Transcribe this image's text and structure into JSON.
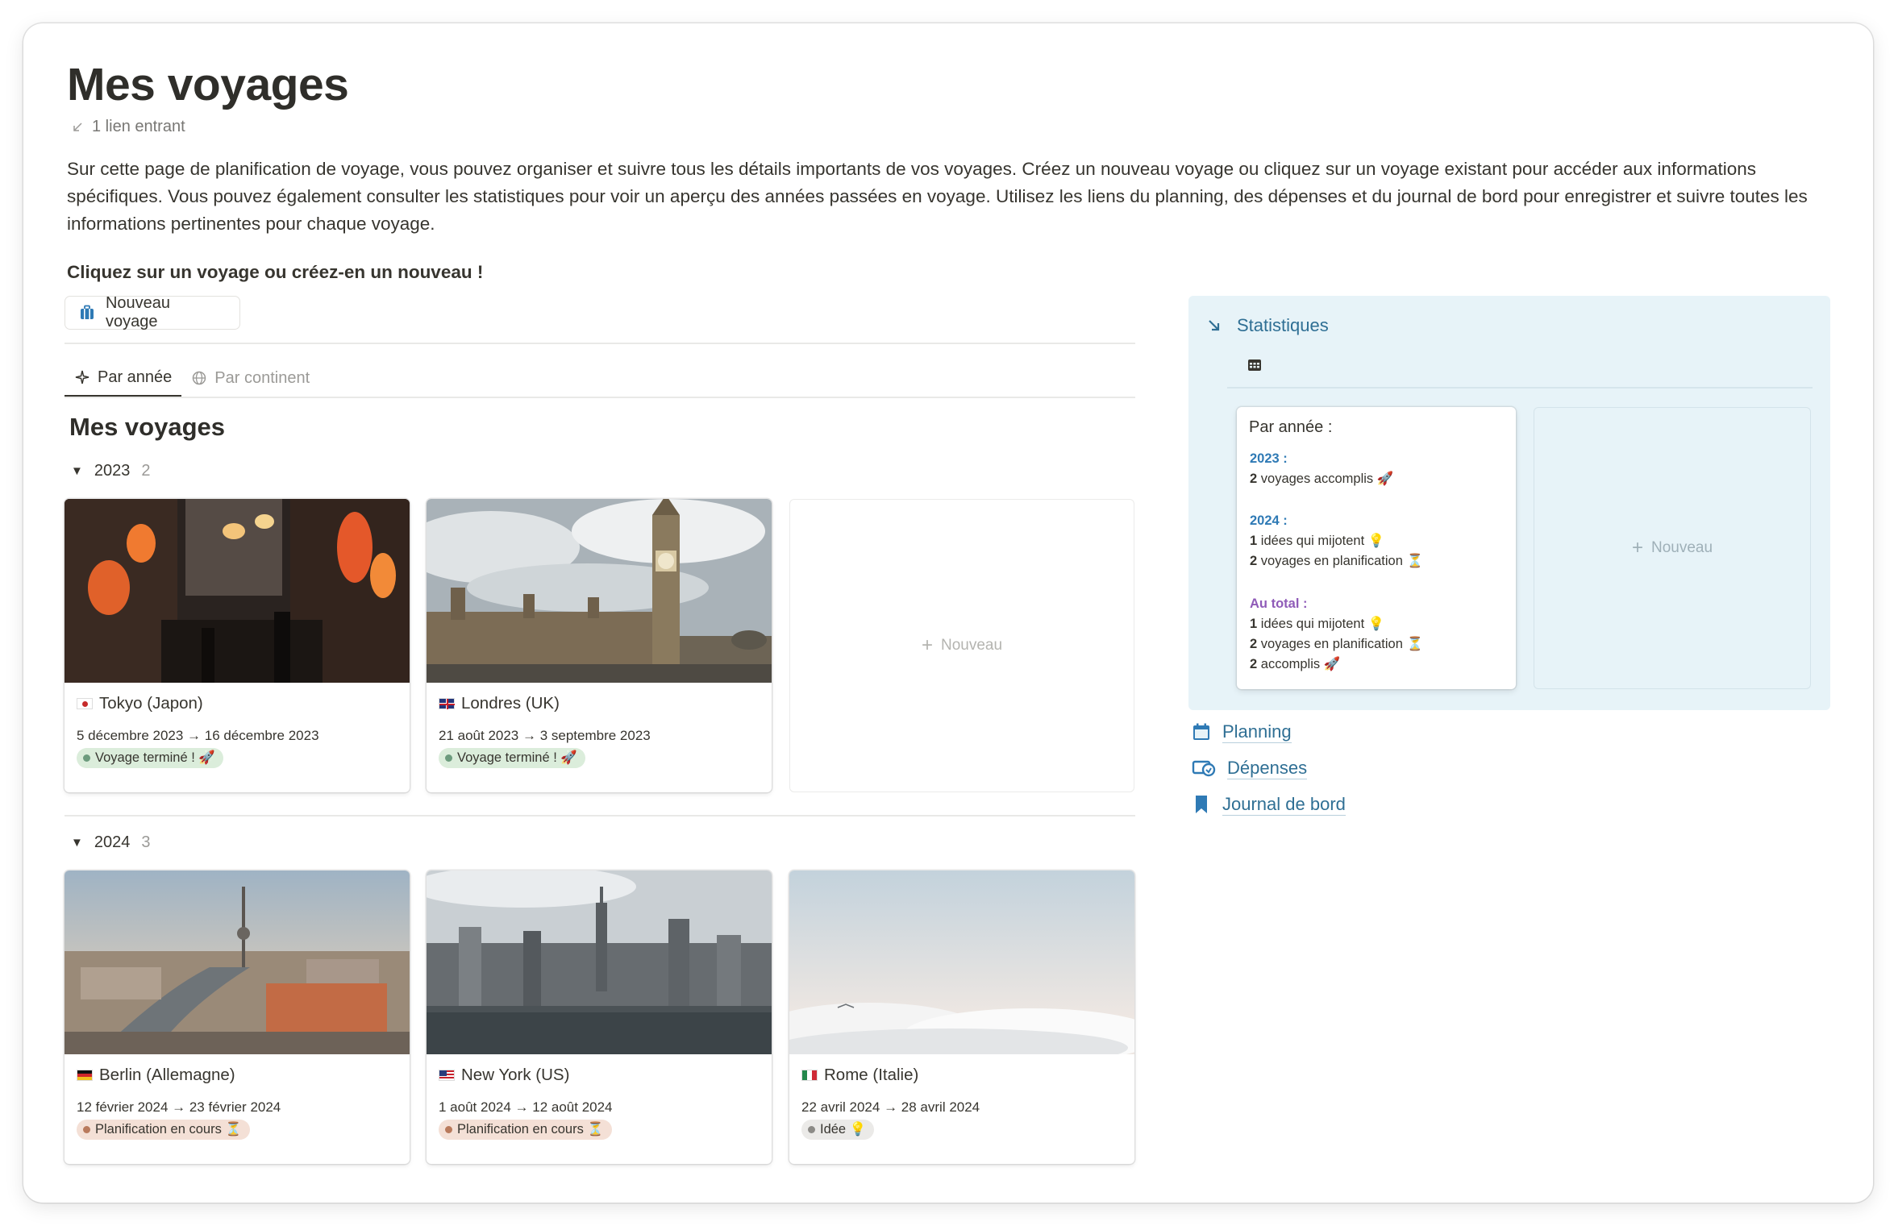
{
  "page": {
    "title": "Mes voyages",
    "backlinks": "1 lien entrant",
    "intro": "Sur cette page de planification de voyage, vous pouvez organiser et suivre tous les détails importants de vos voyages. Créez un nouveau voyage ou cliquez sur un voyage existant pour accéder aux informations spécifiques. Vous pouvez également consulter les statistiques pour voir un aperçu des années passées en voyage. Utilisez les liens du planning, des dépenses et du journal de bord pour enregistrer et suivre toutes les informations pertinentes pour chaque voyage.",
    "cta": "Cliquez sur un voyage ou créez-en un nouveau !",
    "new_trip_button": "Nouveau voyage"
  },
  "tabs": [
    {
      "label": "Par année",
      "icon": "sparkle-icon",
      "active": true
    },
    {
      "label": "Par continent",
      "icon": "globe-icon",
      "active": false
    }
  ],
  "database": {
    "title": "Mes voyages",
    "new_label": "Nouveau",
    "groups": [
      {
        "year": "2023",
        "count": "2",
        "cards": [
          {
            "name": "Tokyo (Japon)",
            "flag": "japan-flag",
            "dates": "5 décembre 2023 → 16 décembre 2023",
            "status": "Voyage terminé ! 🚀",
            "status_color": "#dbeddb",
            "dot_color": "#6c9b7d"
          },
          {
            "name": "Londres (UK)",
            "flag": "uk-flag",
            "dates": "21 août 2023 → 3 septembre 2023",
            "status": "Voyage terminé ! 🚀",
            "status_color": "#dbeddb",
            "dot_color": "#6c9b7d"
          }
        ]
      },
      {
        "year": "2024",
        "count": "3",
        "cards": [
          {
            "name": "Berlin (Allemagne)",
            "flag": "germany-flag",
            "dates": "12 février 2024 → 23 février 2024",
            "status": "Planification en cours ⏳",
            "status_color": "#f4e0d6",
            "dot_color": "#b97a5c"
          },
          {
            "name": "New York (US)",
            "flag": "usa-flag",
            "dates": "1 août 2024 → 12 août 2024",
            "status": "Planification en cours ⏳",
            "status_color": "#f4e0d6",
            "dot_color": "#b97a5c"
          },
          {
            "name": "Rome (Italie)",
            "flag": "italy-flag",
            "dates": "22 avril 2024 → 28 avril 2024",
            "status": "Idée 💡",
            "status_color": "#ebeae8",
            "dot_color": "#8c8b87"
          }
        ]
      }
    ]
  },
  "stats": {
    "title": "Statistiques",
    "new_label": "Nouveau",
    "card": {
      "head": "Par année :",
      "y2023_label": "2023 :",
      "y2023_done_n": "2",
      "y2023_done": " voyages accomplis 🚀",
      "y2024_label": "2024 :",
      "y2024_ideas_n": "1",
      "y2024_ideas": " idées qui mijotent 💡",
      "y2024_plan_n": "2",
      "y2024_plan": " voyages en planification ⏳",
      "total_label": "Au total :",
      "total_ideas_n": "1",
      "total_ideas": " idées qui mijotent 💡",
      "total_plan_n": "2",
      "total_plan": " voyages en planification ⏳",
      "total_done_n": "2",
      "total_done": " accomplis 🚀"
    }
  },
  "links": [
    {
      "label": "Planning",
      "icon": "calendar-icon"
    },
    {
      "label": "Dépenses",
      "icon": "money-icon"
    },
    {
      "label": "Journal de bord",
      "icon": "bookmark-icon"
    }
  ],
  "colors": {
    "accent_blue": "#2f6f94",
    "stats_bg": "#e7f3f8",
    "done_tag": "#dbeddb",
    "planning_tag": "#f4e0d6",
    "idea_tag": "#ebeae8"
  }
}
